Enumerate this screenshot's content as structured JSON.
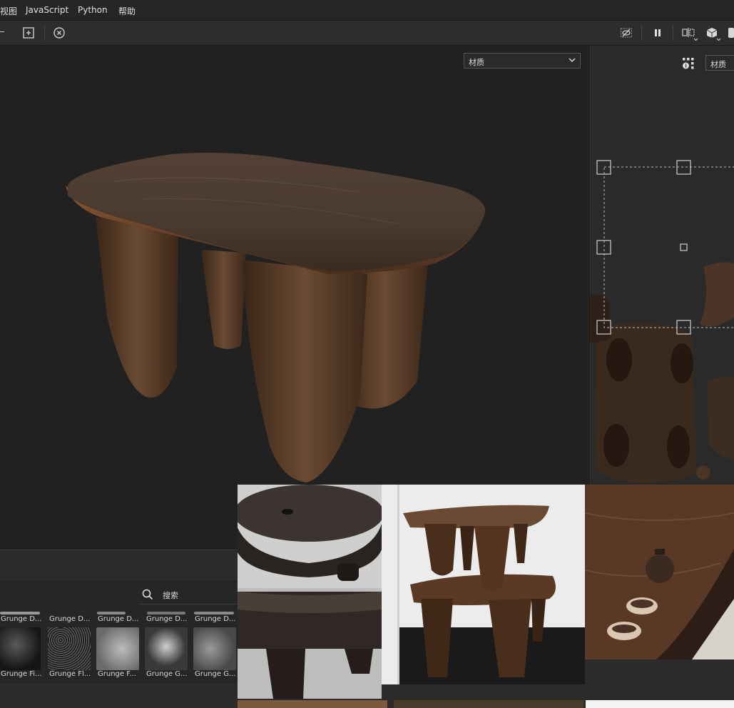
{
  "menu": {
    "items": [
      "视图",
      "JavaScript",
      "Python",
      "帮助"
    ]
  },
  "viewport": {
    "channel_dropdown": "材质"
  },
  "uv_panel": {
    "channel_dropdown": "材质"
  },
  "shelf": {
    "search_placeholder": "搜索",
    "top_row": [
      "Grunge D...",
      "Grunge D...",
      "Grunge D...",
      "Grunge D...",
      "Grunge D..."
    ],
    "bottom_row": [
      "Grunge Fi...",
      "Grunge Fl...",
      "Grunge F...",
      "Grunge G...",
      "Grunge G..."
    ]
  },
  "icons": {
    "toolbar": [
      "fit-view-icon",
      "reset-camera-icon",
      "hide-icon",
      "pause-icon",
      "split-view-icon",
      "cube-icon"
    ],
    "uv": [
      "grid-info-icon"
    ]
  },
  "colors": {
    "menubar_bg": "#252526",
    "viewport_bg": "#212121",
    "wood_dark": "#3b2a1e",
    "wood_mid": "#5a3e2a"
  }
}
